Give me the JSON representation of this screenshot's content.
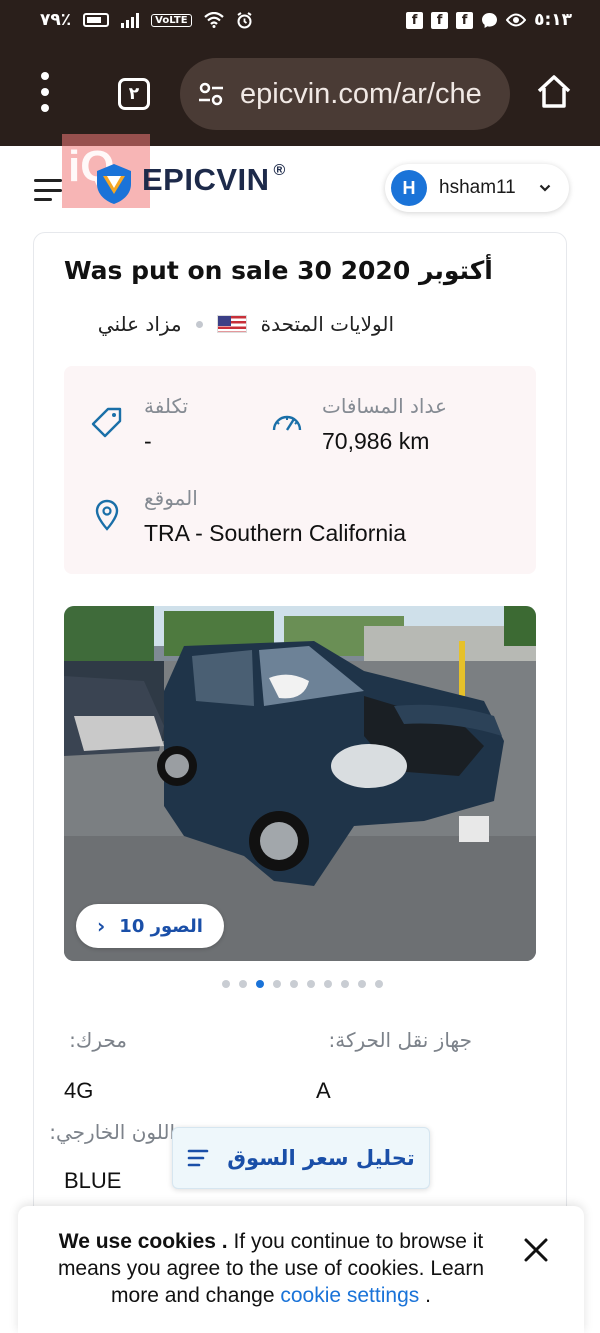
{
  "status_bar": {
    "battery": "٧٩٪",
    "network": "VoLTE",
    "time": "٥:١٣",
    "icons": [
      "battery-icon",
      "signal-icon",
      "volte-icon",
      "wifi-icon",
      "alarm-icon",
      "facebook-icon",
      "facebook-icon",
      "facebook-icon",
      "messenger-icon",
      "eye-icon"
    ],
    "fb_glyph": "f"
  },
  "browser": {
    "url": "epicvin.com/ar/che",
    "tab_count": "٢"
  },
  "site": {
    "logo_prefix": "EPIC",
    "logo_suffix": "VIN",
    "logo_reg": "®",
    "watermark": "iQ",
    "user_initial": "H",
    "user_name": "hsham11",
    "brand_color": "#1a73d8"
  },
  "listing": {
    "title": "Was put on sale 30 أكتوبر 2020",
    "country": "الولايات المتحدة",
    "auction_type": "مزاد علني",
    "cost_label": "تكلفة",
    "cost_value": "-",
    "odometer_label": "عداد المسافات",
    "odometer_value": "70,986 km",
    "location_label": "الموقع",
    "location_value": "TRA - Southern California",
    "photos_button": "الصور 10",
    "photos_arrow": "›",
    "slide_count": 10,
    "active_slide": 3,
    "engine_label": "محرك:",
    "engine_value": "4G",
    "transmission_label": "جهاز نقل الحركة:",
    "transmission_value": "A",
    "exterior_color_label": "اللون الخارجي:",
    "exterior_color_value": "BLUE",
    "market_button": "تحليل سعر السوق"
  },
  "cookie": {
    "bold": "We use cookies .",
    "text": " If you continue to browse it means you agree to the use of cookies. Learn more and change ",
    "link": "cookie settings",
    "end": " ."
  }
}
